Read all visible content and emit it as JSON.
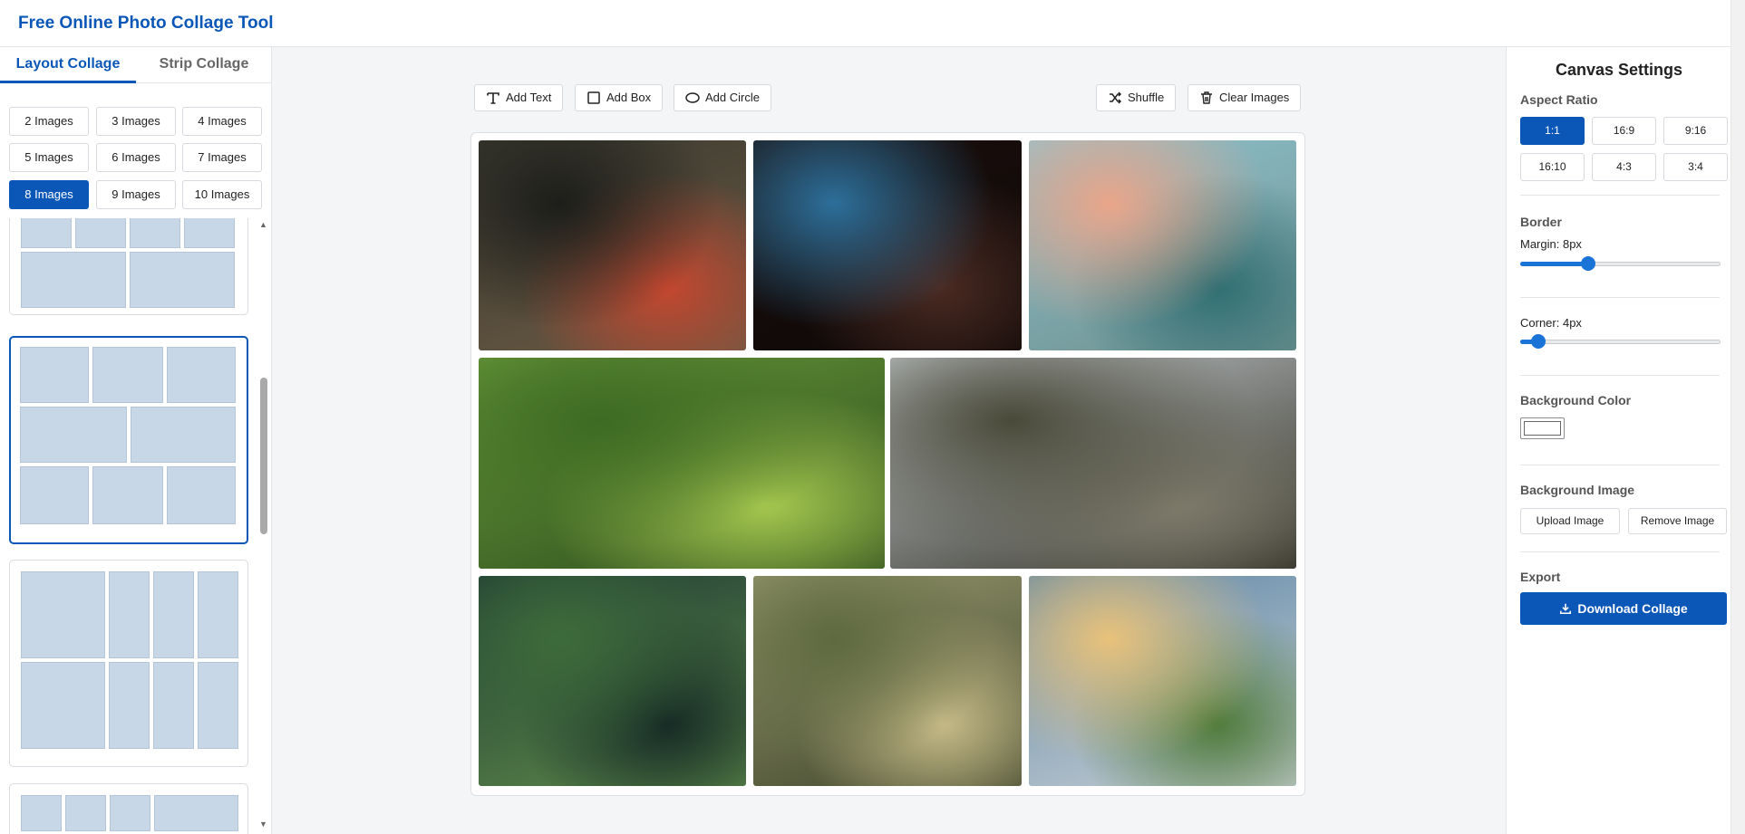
{
  "app": {
    "title": "Free Online Photo Collage Tool"
  },
  "sidebar": {
    "tabs": [
      {
        "label": "Layout Collage",
        "active": true
      },
      {
        "label": "Strip Collage",
        "active": false
      }
    ],
    "image_counts": [
      {
        "label": "2 Images",
        "active": false
      },
      {
        "label": "3 Images",
        "active": false
      },
      {
        "label": "4 Images",
        "active": false
      },
      {
        "label": "5 Images",
        "active": false
      },
      {
        "label": "6 Images",
        "active": false
      },
      {
        "label": "7 Images",
        "active": false
      },
      {
        "label": "8 Images",
        "active": true
      },
      {
        "label": "9 Images",
        "active": false
      },
      {
        "label": "10 Images",
        "active": false
      }
    ]
  },
  "toolbar": {
    "add_text": "Add Text",
    "add_box": "Add Box",
    "add_circle": "Add Circle",
    "shuffle": "Shuffle",
    "clear_images": "Clear Images"
  },
  "canvas": {
    "photos": [
      {
        "subject": "red mushroom in forest",
        "colors": [
          "#3b3a30",
          "#1d1e1a",
          "#c5472f",
          "#6b5a44"
        ]
      },
      {
        "subject": "cave opening with starry sky",
        "colors": [
          "#1a0f0d",
          "#2d6f9a",
          "#4a2a22",
          "#0d0807"
        ]
      },
      {
        "subject": "mountain lake at sunset",
        "colors": [
          "#8fc3cf",
          "#e9a58a",
          "#2f6e72",
          "#6e8f8d"
        ]
      },
      {
        "subject": "green rolling hills",
        "colors": [
          "#6a9a3a",
          "#3e6b23",
          "#a6c84f",
          "#2a4a1c"
        ]
      },
      {
        "subject": "granite cliff with pine trees",
        "colors": [
          "#c9cfd2",
          "#4a4a3a",
          "#7d7a6a",
          "#2b2a20"
        ]
      },
      {
        "subject": "small fir seedling",
        "colors": [
          "#1f3a34",
          "#3d6b3a",
          "#152a25",
          "#5e8a4a"
        ]
      },
      {
        "subject": "misty valley with rock spires",
        "colors": [
          "#9a9a70",
          "#5f6a40",
          "#c7bb88",
          "#3d442a"
        ]
      },
      {
        "subject": "clouds over green valley",
        "colors": [
          "#5d86a6",
          "#e8c27a",
          "#4f7a3a",
          "#c9d0d4"
        ]
      }
    ]
  },
  "settings": {
    "title": "Canvas Settings",
    "aspect_ratio_label": "Aspect Ratio",
    "aspect_ratios": [
      {
        "label": "1:1",
        "active": true
      },
      {
        "label": "16:9",
        "active": false
      },
      {
        "label": "9:16",
        "active": false
      },
      {
        "label": "16:10",
        "active": false
      },
      {
        "label": "4:3",
        "active": false
      },
      {
        "label": "3:4",
        "active": false
      }
    ],
    "border_label": "Border",
    "margin_label": "Margin: 8px",
    "margin_level": 0.34,
    "corner_label": "Corner: 4px",
    "corner_level": 0.09,
    "background_color_label": "Background Color",
    "background_color": "#ffffff",
    "background_image_label": "Background Image",
    "upload_image": "Upload Image",
    "remove_image": "Remove Image",
    "export_label": "Export",
    "download": "Download Collage"
  },
  "colors": {
    "accent": "#0b57b7",
    "slider": "#1a73d6"
  }
}
